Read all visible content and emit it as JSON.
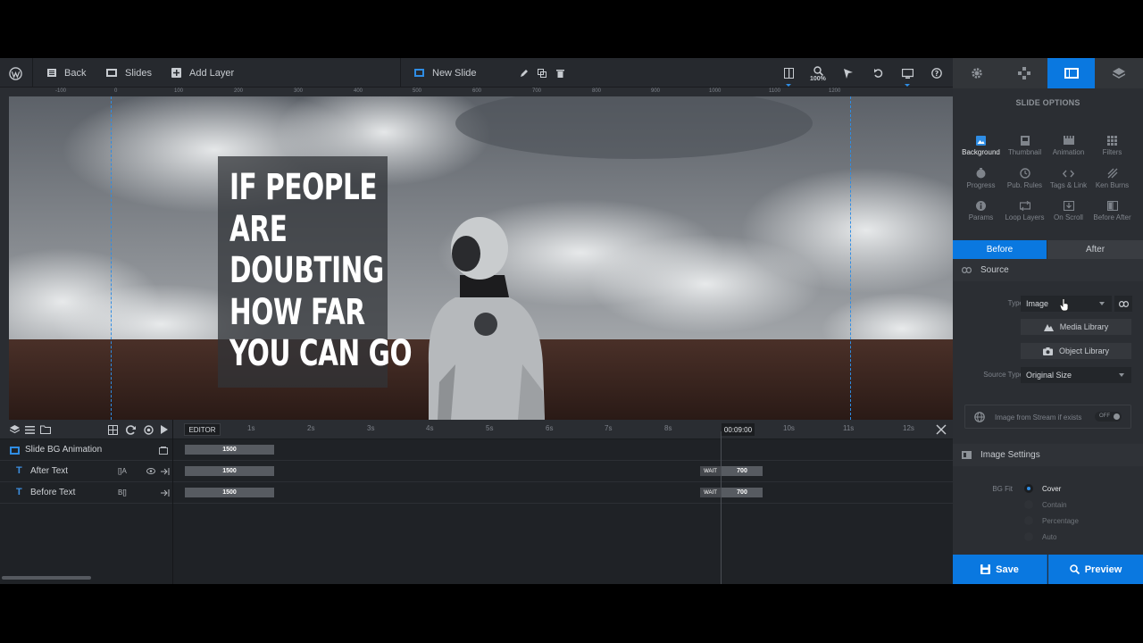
{
  "toolbar": {
    "back_label": "Back",
    "slides_label": "Slides",
    "add_layer_label": "Add Layer",
    "slide_name": "New Slide",
    "zoom": "100%"
  },
  "ruler": {
    "h_ticks": [
      "-100",
      "0",
      "100",
      "200",
      "300",
      "400",
      "500",
      "600",
      "700",
      "800",
      "900",
      "1000",
      "1100",
      "1200"
    ]
  },
  "canvas": {
    "headline_lines": [
      "IF PEOPLE",
      "ARE",
      "DOUBTING",
      "HOW FAR",
      "YOU CAN GO"
    ]
  },
  "timeline": {
    "editor_label": "EDITOR",
    "seconds": [
      "1s",
      "2s",
      "3s",
      "4s",
      "5s",
      "6s",
      "7s",
      "8s",
      "9s",
      "10s",
      "11s",
      "12s"
    ],
    "time_marker": "00:09:00",
    "rows": [
      {
        "name": "Slide BG Animation",
        "bar": "1500"
      },
      {
        "name": "After Text",
        "ctrl": "[]A",
        "bar": "1500",
        "wait": "WAIT",
        "end": "700"
      },
      {
        "name": "Before Text",
        "ctrl": "B[]",
        "bar": "1500",
        "wait": "WAIT",
        "end": "700"
      }
    ]
  },
  "panel": {
    "title": "SLIDE OPTIONS",
    "options": [
      {
        "label": "Background",
        "icon": "image-icon"
      },
      {
        "label": "Thumbnail",
        "icon": "thumbnail-icon"
      },
      {
        "label": "Animation",
        "icon": "animation-icon"
      },
      {
        "label": "Filters",
        "icon": "filters-icon"
      },
      {
        "label": "Progress",
        "icon": "progress-icon"
      },
      {
        "label": "Pub. Rules",
        "icon": "clock-icon"
      },
      {
        "label": "Tags & Link",
        "icon": "code-icon"
      },
      {
        "label": "Ken Burns",
        "icon": "kenburns-icon"
      },
      {
        "label": "Params",
        "icon": "info-icon"
      },
      {
        "label": "Loop Layers",
        "icon": "loop-icon"
      },
      {
        "label": "On Scroll",
        "icon": "scroll-icon"
      },
      {
        "label": "Before After",
        "icon": "before-after-icon"
      }
    ],
    "before_label": "Before",
    "after_label": "After",
    "source_header": "Source",
    "type_label": "Type",
    "type_value": "Image",
    "media_library": "Media Library",
    "object_library": "Object Library",
    "source_type_label": "Source Type",
    "source_type_value": "Original Size",
    "stream_label": "Image from Stream if exists",
    "stream_toggle": "OFF",
    "image_settings_header": "Image Settings",
    "bgfit_label": "BG Fit",
    "bgfit_options": [
      "Cover",
      "Contain",
      "Percentage",
      "Auto"
    ],
    "save_label": "Save",
    "preview_label": "Preview"
  },
  "colors": {
    "accent": "#0a78e0",
    "guide": "#2f8de4"
  }
}
